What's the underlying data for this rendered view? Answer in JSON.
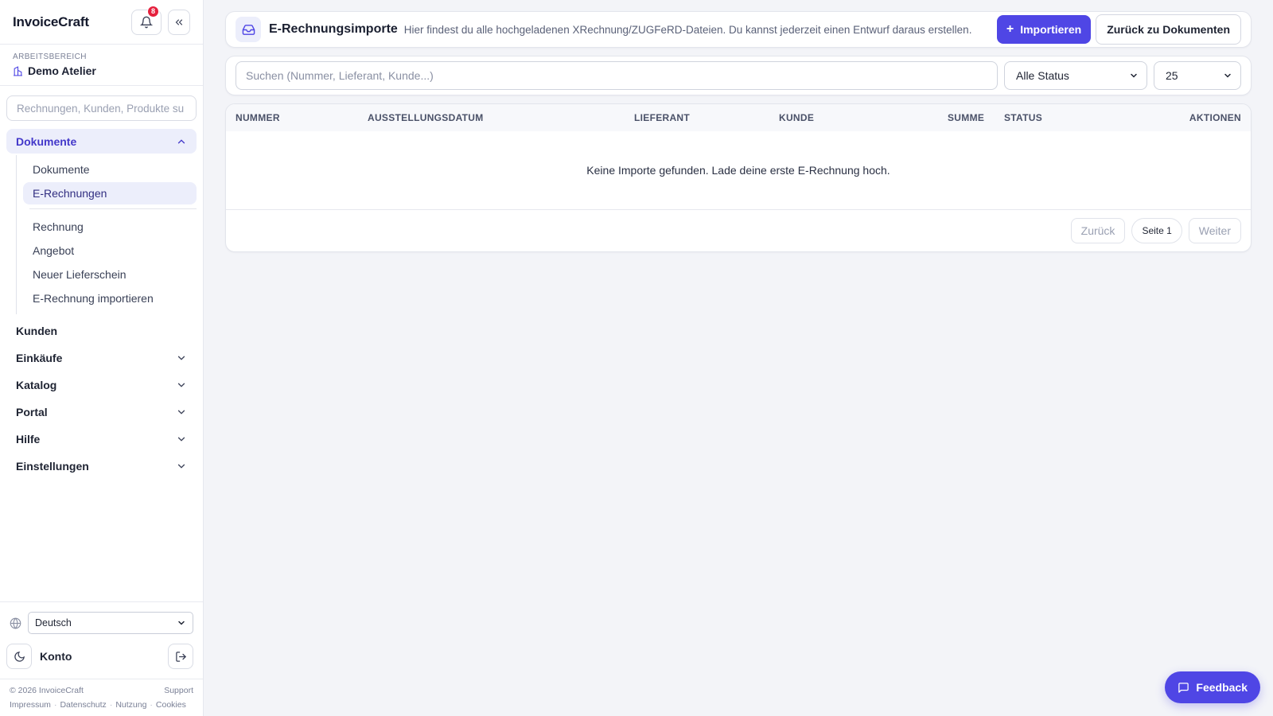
{
  "brand": "InvoiceCraft",
  "notifications": {
    "count": "8"
  },
  "workspace": {
    "label": "ARBEITSBEREICH",
    "name": "Demo Atelier"
  },
  "sidebar_search": {
    "placeholder": "Rechnungen, Kunden, Produkte su"
  },
  "nav": {
    "documents": {
      "label": "Dokumente",
      "sub": [
        "Dokumente",
        "E-Rechnungen"
      ],
      "create": [
        "Rechnung",
        "Angebot",
        "Neuer Lieferschein",
        "E-Rechnung importieren"
      ]
    },
    "customers": "Kunden",
    "purchases": "Einkäufe",
    "catalog": "Katalog",
    "portal": "Portal",
    "help": "Hilfe",
    "settings": "Einstellungen"
  },
  "language": {
    "selected": "Deutsch"
  },
  "account": {
    "label": "Konto"
  },
  "footer": {
    "copyright": "© 2026 InvoiceCraft",
    "support": "Support",
    "links": [
      "Impressum",
      "Datenschutz",
      "Nutzung",
      "Cookies"
    ]
  },
  "header": {
    "title": "E-Rechnungsimporte",
    "description": "Hier findest du alle hochgeladenen XRechnung/ZUGFeRD-Dateien. Du kannst jederzeit einen Entwurf daraus erstellen.",
    "import_label": "Importieren",
    "back_label": "Zurück zu Dokumenten"
  },
  "filters": {
    "search_placeholder": "Suchen (Nummer, Lieferant, Kunde...)",
    "status": "Alle Status",
    "per_page": "25"
  },
  "table": {
    "columns": [
      "NUMMER",
      "AUSSTELLUNGSDATUM",
      "LIEFERANT",
      "KUNDE",
      "SUMME",
      "STATUS",
      "AKTIONEN"
    ],
    "empty": "Keine Importe gefunden. Lade deine erste E-Rechnung hoch."
  },
  "pager": {
    "prev": "Zurück",
    "current": "Seite 1",
    "next": "Weiter"
  },
  "feedback": {
    "label": "Feedback"
  },
  "colors": {
    "accent": "#4f46e5",
    "badge": "#e5203d"
  }
}
